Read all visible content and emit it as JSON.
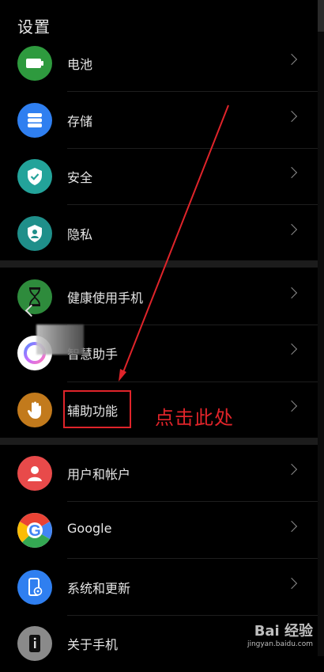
{
  "header": {
    "title": "设置"
  },
  "group1": [
    {
      "label": "电池",
      "icon": "battery-icon",
      "color": "#2e9a3e"
    },
    {
      "label": "存储",
      "icon": "storage-icon",
      "color": "#2f7ff0"
    },
    {
      "label": "安全",
      "icon": "shield-check-icon",
      "color": "#23a39a"
    },
    {
      "label": "隐私",
      "icon": "privacy-person-icon",
      "color": "#1f8f8a"
    }
  ],
  "group2": [
    {
      "label": "健康使用手机",
      "icon": "hourglass-icon",
      "color": "#2e8b3c"
    },
    {
      "label": "智慧助手",
      "icon": "assistant-ring-icon",
      "color": "#ffffff"
    },
    {
      "label": "辅助功能",
      "icon": "hand-icon",
      "color": "#c27a1c"
    }
  ],
  "group3": [
    {
      "label": "用户和帐户",
      "icon": "user-icon",
      "color": "#e84a4a"
    },
    {
      "label": "Google",
      "icon": "google-icon",
      "color": "#ffffff"
    },
    {
      "label": "系统和更新",
      "icon": "phone-update-icon",
      "color": "#2f7ff0"
    },
    {
      "label": "关于手机",
      "icon": "phone-info-icon",
      "color": "#8a8a8a"
    }
  ],
  "annotation": {
    "text": "点击此处",
    "color": "#e0242a"
  },
  "watermark": {
    "brand": "Bai 经验",
    "url": "jingyan.baidu.com"
  }
}
